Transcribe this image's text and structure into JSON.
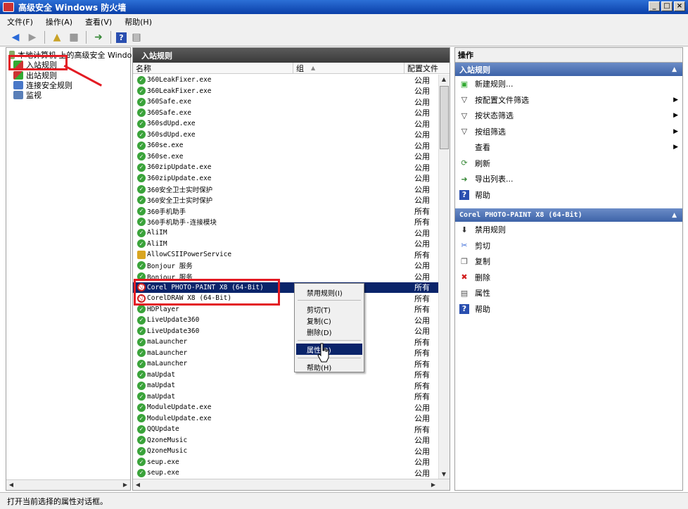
{
  "window": {
    "title": "高级安全 Windows 防火墙",
    "btn_min": "_",
    "btn_max": "□",
    "btn_close": "×"
  },
  "menu": [
    "文件(F)",
    "操作(A)",
    "查看(V)",
    "帮助(H)"
  ],
  "tree": {
    "root": "本地计算机 上的高级安全 Window",
    "items": [
      "入站规则",
      "出站规则",
      "连接安全规则",
      "监视"
    ]
  },
  "center": {
    "title": "入站规则",
    "columns": {
      "name": "名称",
      "group": "组",
      "profile": "配置文件"
    },
    "rows": [
      {
        "name": "360LeakFixer.exe",
        "profile": "公用",
        "status": "allow"
      },
      {
        "name": "360LeakFixer.exe",
        "profile": "公用",
        "status": "allow"
      },
      {
        "name": "360Safe.exe",
        "profile": "公用",
        "status": "allow"
      },
      {
        "name": "360Safe.exe",
        "profile": "公用",
        "status": "allow"
      },
      {
        "name": "360sdUpd.exe",
        "profile": "公用",
        "status": "allow"
      },
      {
        "name": "360sdUpd.exe",
        "profile": "公用",
        "status": "allow"
      },
      {
        "name": "360se.exe",
        "profile": "公用",
        "status": "allow"
      },
      {
        "name": "360se.exe",
        "profile": "公用",
        "status": "allow"
      },
      {
        "name": "360zipUpdate.exe",
        "profile": "公用",
        "status": "allow"
      },
      {
        "name": "360zipUpdate.exe",
        "profile": "公用",
        "status": "allow"
      },
      {
        "name": "360安全卫士实时保护",
        "profile": "公用",
        "status": "allow"
      },
      {
        "name": "360安全卫士实时保护",
        "profile": "公用",
        "status": "allow"
      },
      {
        "name": "360手机助手",
        "profile": "所有",
        "status": "allow"
      },
      {
        "name": "360手机助手-连接模块",
        "profile": "所有",
        "status": "allow"
      },
      {
        "name": "AliIM",
        "profile": "公用",
        "status": "allow"
      },
      {
        "name": "AliIM",
        "profile": "公用",
        "status": "allow"
      },
      {
        "name": "AllowCSIIPowerService",
        "profile": "所有",
        "status": "lock"
      },
      {
        "name": "Bonjour 服务",
        "profile": "公用",
        "status": "allow"
      },
      {
        "name": "Bonjour 服务",
        "profile": "公用",
        "status": "allow"
      },
      {
        "name": "Corel PHOTO-PAINT X8 (64-Bit)",
        "profile": "所有",
        "status": "block",
        "selected": true
      },
      {
        "name": "CorelDRAW X8 (64-Bit)",
        "profile": "所有",
        "status": "block"
      },
      {
        "name": "HDPlayer",
        "profile": "所有",
        "status": "allow"
      },
      {
        "name": "LiveUpdate360",
        "profile": "公用",
        "status": "allow"
      },
      {
        "name": "LiveUpdate360",
        "profile": "公用",
        "status": "allow"
      },
      {
        "name": "maLauncher",
        "profile": "所有",
        "status": "allow"
      },
      {
        "name": "maLauncher",
        "profile": "所有",
        "status": "allow"
      },
      {
        "name": "maLauncher",
        "profile": "所有",
        "status": "allow"
      },
      {
        "name": "maUpdat",
        "profile": "所有",
        "status": "allow"
      },
      {
        "name": "maUpdat",
        "profile": "所有",
        "status": "allow"
      },
      {
        "name": "maUpdat",
        "profile": "所有",
        "status": "allow"
      },
      {
        "name": "ModuleUpdate.exe",
        "profile": "公用",
        "status": "allow"
      },
      {
        "name": "ModuleUpdate.exe",
        "profile": "公用",
        "status": "allow"
      },
      {
        "name": "QQUpdate",
        "profile": "所有",
        "status": "allow"
      },
      {
        "name": "QzoneMusic",
        "profile": "公用",
        "status": "allow"
      },
      {
        "name": "QzoneMusic",
        "profile": "公用",
        "status": "allow"
      },
      {
        "name": "seup.exe",
        "profile": "公用",
        "status": "allow"
      },
      {
        "name": "seup.exe",
        "profile": "公用",
        "status": "allow"
      }
    ]
  },
  "context_menu": {
    "disable": "禁用规则(I)",
    "cut": "剪切(T)",
    "copy": "复制(C)",
    "delete": "删除(D)",
    "properties": "属性(R)",
    "help": "帮助(H)"
  },
  "actions": {
    "title": "操作",
    "section1": "入站规则",
    "section1_items": [
      {
        "label": "新建规则...",
        "icon": "new-rule-icon",
        "arrow": false
      },
      {
        "label": "按配置文件筛选",
        "icon": "filter-icon",
        "arrow": true
      },
      {
        "label": "按状态筛选",
        "icon": "filter-icon",
        "arrow": true
      },
      {
        "label": "按组筛选",
        "icon": "filter-icon",
        "arrow": true
      },
      {
        "label": "查看",
        "icon": "",
        "arrow": true
      },
      {
        "label": "刷新",
        "icon": "refresh-icon",
        "arrow": false
      },
      {
        "label": "导出列表...",
        "icon": "export-icon",
        "arrow": false
      },
      {
        "label": "帮助",
        "icon": "help-icon",
        "arrow": false
      }
    ],
    "section2": "Corel PHOTO-PAINT X8 (64-Bit)",
    "section2_items": [
      {
        "label": "禁用规则",
        "icon": "disable-icon"
      },
      {
        "label": "剪切",
        "icon": "cut-icon"
      },
      {
        "label": "复制",
        "icon": "copy-icon"
      },
      {
        "label": "删除",
        "icon": "delete-icon"
      },
      {
        "label": "属性",
        "icon": "properties-icon"
      },
      {
        "label": "帮助",
        "icon": "help-icon"
      }
    ]
  },
  "status": "打开当前选择的属性对话框。",
  "colors": {
    "accent": "#0a246a",
    "allow": "#3aa33a",
    "block": "#d21f1f",
    "annotation": "#e31b23"
  }
}
